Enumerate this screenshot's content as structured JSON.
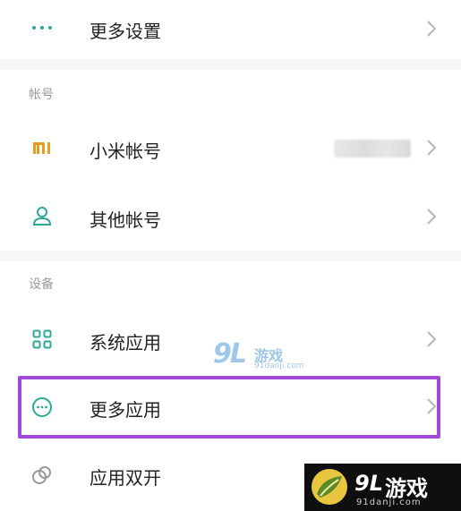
{
  "sections": {
    "account": "帐号",
    "device": "设备"
  },
  "items": {
    "more_settings": {
      "label": "更多设置",
      "icon": "dots-icon"
    },
    "mi_account": {
      "label": "小米帐号",
      "icon": "mi-logo-icon"
    },
    "other_account": {
      "label": "其他帐号",
      "icon": "person-icon"
    },
    "system_apps": {
      "label": "系统应用",
      "icon": "grid-icon"
    },
    "more_apps": {
      "label": "更多应用",
      "icon": "circle-dots-icon"
    },
    "dual_apps": {
      "label": "应用双开",
      "icon": "dual-circle-icon"
    }
  },
  "watermark": {
    "center_big": "9L",
    "center_text": "游戏",
    "center_url": "91danji.com",
    "corner_big": "9L",
    "corner_text": "游戏",
    "corner_url": "91danji.com"
  },
  "colors": {
    "accent": "#2ea79a",
    "mi_orange": "#ef9a1c",
    "highlight": "#a24ad8",
    "gap": "#f6f6f6"
  }
}
